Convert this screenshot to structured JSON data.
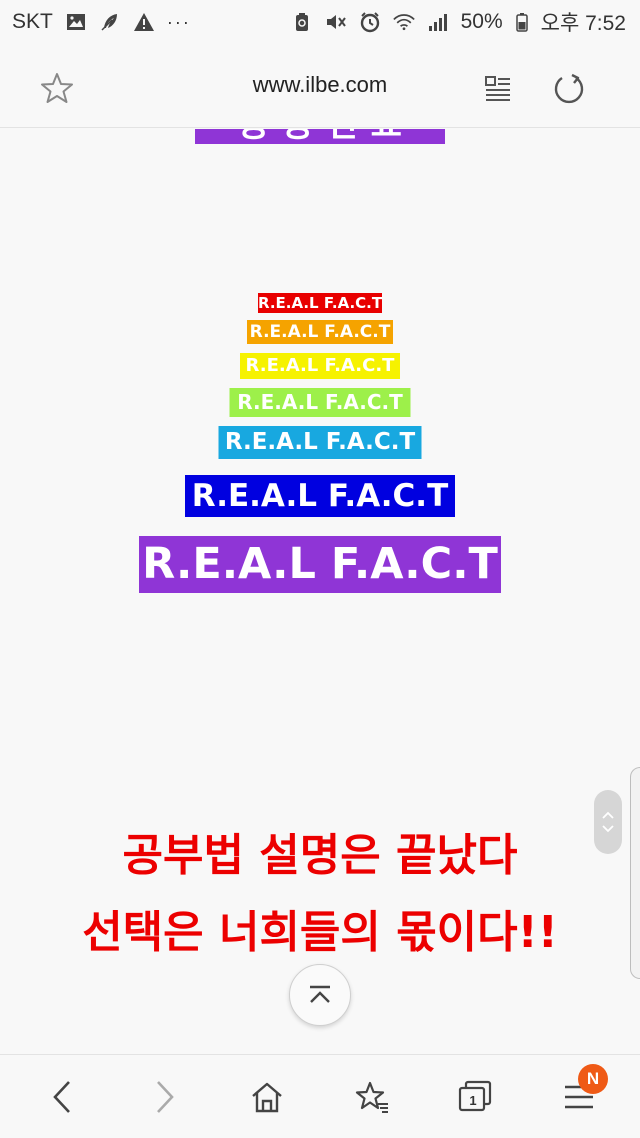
{
  "status_bar": {
    "carrier": "SKT",
    "battery": "50%",
    "time": "오후 7:52",
    "left_icons": [
      "image-icon",
      "feather-icon",
      "warning-icon",
      "more-dots-icon"
    ],
    "right_icons": [
      "recycle-battery-icon",
      "mute-icon",
      "alarm-icon",
      "wifi-icon",
      "signal-icon",
      "battery-icon"
    ],
    "more_dots": "···"
  },
  "url_bar": {
    "url": "www.ilbe.com"
  },
  "content": {
    "partial_title": "공·공·인·표",
    "fact_lines": [
      {
        "text": "R.E.A.L F.A.C.T",
        "color": "#e80000"
      },
      {
        "text": "R.E.A.L F.A.C.T",
        "color": "#f5a300"
      },
      {
        "text": "R.E.A.L F.A.C.T",
        "color": "#f6f200"
      },
      {
        "text": "R.E.A.L F.A.C.T",
        "color": "#9df04a"
      },
      {
        "text": "R.E.A.L F.A.C.T",
        "color": "#18a8e0"
      },
      {
        "text": "R.E.A.L F.A.C.T",
        "color": "#0000e0"
      },
      {
        "text": "R.E.A.L F.A.C.T",
        "color": "#8f35d6"
      }
    ],
    "red_lines": [
      "공부법 설명은 끝났다",
      "선택은 너희들의 몫이다!!"
    ],
    "accent_red": "#ec0000"
  },
  "bottom_bar": {
    "tabs_count": "1",
    "notification_badge": "N",
    "badge_color": "#ef5a16"
  }
}
